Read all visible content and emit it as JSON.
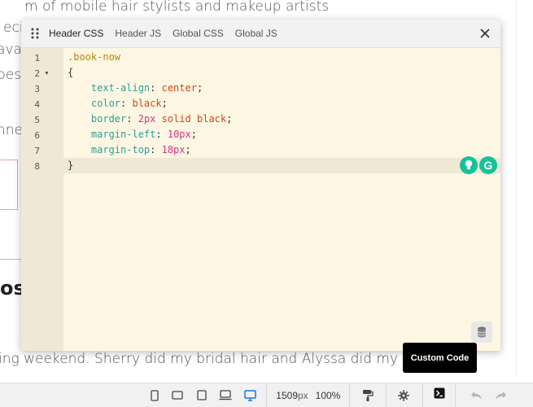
{
  "background": {
    "text_lines": [
      "m of mobile hair stylists and makeup artists",
      "ecial",
      "ava",
      "bes",
      "nne",
      "ing weekend. Sherry did my bridal hair and Alyssa did my"
    ],
    "heading": "os"
  },
  "modal": {
    "tabs": [
      {
        "label": "Header CSS",
        "active": true
      },
      {
        "label": "Header JS",
        "active": false
      },
      {
        "label": "Global CSS",
        "active": false
      },
      {
        "label": "Global JS",
        "active": false
      }
    ],
    "line_numbers": [
      "1",
      "2",
      "3",
      "4",
      "5",
      "6",
      "7",
      "8"
    ],
    "code": {
      "selector": ".book-now",
      "open_brace": "{",
      "close_brace": "}",
      "declarations": [
        {
          "prop": "text-align",
          "value": "center",
          "value_type": "keyword"
        },
        {
          "prop": "color",
          "value": "black",
          "value_type": "keyword"
        },
        {
          "prop": "border",
          "value": "2px solid black",
          "value_type": "mixed",
          "num": "2px",
          "rest": "solid black"
        },
        {
          "prop": "margin-left",
          "value": "10px",
          "value_type": "number"
        },
        {
          "prop": "margin-top",
          "value": "18px",
          "value_type": "number"
        }
      ]
    },
    "grammarly_letter": "G"
  },
  "tooltip": {
    "label": "Custom Code"
  },
  "toolbar": {
    "width_value": "1509",
    "width_unit": "px",
    "zoom": "100%"
  },
  "colors": {
    "editor_bg": "#fdf6e3",
    "gutter_bg": "#eee8d5",
    "selector": "#b58900",
    "property": "#2aa198",
    "value": "#d33682",
    "grammarly": "#15c39a",
    "active_device": "#1a73e8"
  },
  "icons": {
    "drag": "drag-handle-icon",
    "close": "close-icon",
    "grammarly_bulb": "lightbulb-icon",
    "database": "database-icon",
    "devices": [
      "mobile-icon",
      "tablet-landscape-icon",
      "tablet-icon",
      "laptop-icon",
      "desktop-icon"
    ],
    "brush": "paint-roller-icon",
    "settings": "gear-icon",
    "code": "terminal-icon",
    "undo": "undo-icon",
    "redo": "redo-icon"
  }
}
